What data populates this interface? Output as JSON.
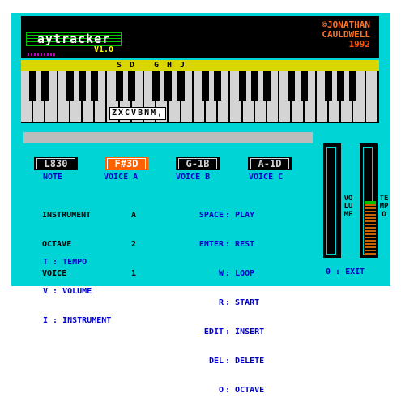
{
  "header": {
    "logo": "aytracker",
    "version": "V1.0",
    "author_line1": "©JONATHAN",
    "author_line2": "CAULDWELL",
    "year": "1992"
  },
  "keyboard": {
    "upper_keys": [
      "S",
      "D",
      "G",
      "H",
      "J"
    ],
    "lower_keys": "ZXCVBNM,"
  },
  "voices": [
    {
      "value": "L830",
      "label": "NOTE",
      "active": false
    },
    {
      "value": "F#3D",
      "label": "VOICE A",
      "active": true
    },
    {
      "value": "G-1B",
      "label": "VOICE B",
      "active": false
    },
    {
      "value": "A-1D",
      "label": "VOICE C",
      "active": false
    }
  ],
  "settings": {
    "instrument_label": "INSTRUMENT",
    "instrument_value": "A",
    "octave_label": "OCTAVE",
    "octave_value": "2",
    "voice_label": "VOICE",
    "voice_value": "1"
  },
  "hotkeys_left": [
    {
      "key": "T",
      "action": "TEMPO"
    },
    {
      "key": "V",
      "action": "VOLUME"
    },
    {
      "key": "I",
      "action": "INSTRUMENT"
    }
  ],
  "hotkeys_right": [
    {
      "key": "SPACE",
      "action": "PLAY"
    },
    {
      "key": "ENTER",
      "action": "REST"
    },
    {
      "key": "W",
      "action": "LOOP"
    },
    {
      "key": "R",
      "action": "START"
    },
    {
      "key": "EDIT",
      "action": "INSERT"
    },
    {
      "key": "DEL",
      "action": "DELETE"
    },
    {
      "key": "O",
      "action": "OCTAVE"
    }
  ],
  "exit": {
    "key": "0",
    "action": "EXIT"
  },
  "meters": {
    "volume_label": "VOLUME",
    "tempo_label": "TEMPO",
    "volume_level": 0,
    "tempo_level": 0.5
  },
  "colors": {
    "paper": "#00d4d4",
    "active_voice": "#ff6000",
    "label_blue": "#0000c8",
    "author_orange": "#ff7020"
  }
}
